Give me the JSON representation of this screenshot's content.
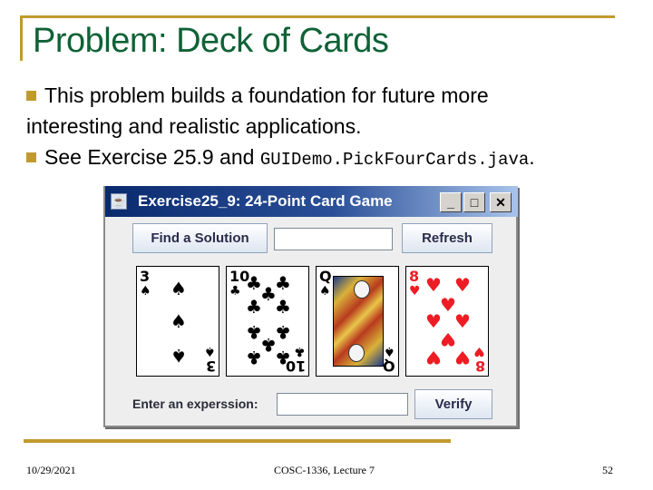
{
  "slide": {
    "title": "Problem: Deck of Cards",
    "bullets": [
      {
        "text_line1": "This problem builds a foundation for future more",
        "text_line2": "interesting and realistic applications."
      },
      {
        "text": "See Exercise 25.9 and ",
        "code": "GUIDemo.PickFourCards.java",
        "code_suffix": "."
      }
    ],
    "footer": {
      "date": "10/29/2021",
      "course": "COSC-1336, Lecture 7",
      "page": "52"
    },
    "accent_color": "#c19a2e",
    "title_color": "#0f6236"
  },
  "window": {
    "title": "Exercise25_9: 24-Point Card Game",
    "app_icon": "java-cup-icon",
    "controls": {
      "minimize": "_",
      "maximize": "□",
      "close": "✕"
    },
    "find_solution_label": "Find a Solution",
    "solution_field_value": "",
    "refresh_label": "Refresh",
    "expression_label": "Enter an experssion:",
    "expression_field_value": "",
    "verify_label": "Verify",
    "cards": [
      {
        "rank": "3",
        "suit": "♠",
        "suit_name": "spades",
        "color": "black"
      },
      {
        "rank": "10",
        "suit": "♣",
        "suit_name": "clubs",
        "color": "black"
      },
      {
        "rank": "Q",
        "suit": "♠",
        "suit_name": "spades",
        "color": "black"
      },
      {
        "rank": "8",
        "suit": "♥",
        "suit_name": "hearts",
        "color": "red"
      }
    ]
  }
}
